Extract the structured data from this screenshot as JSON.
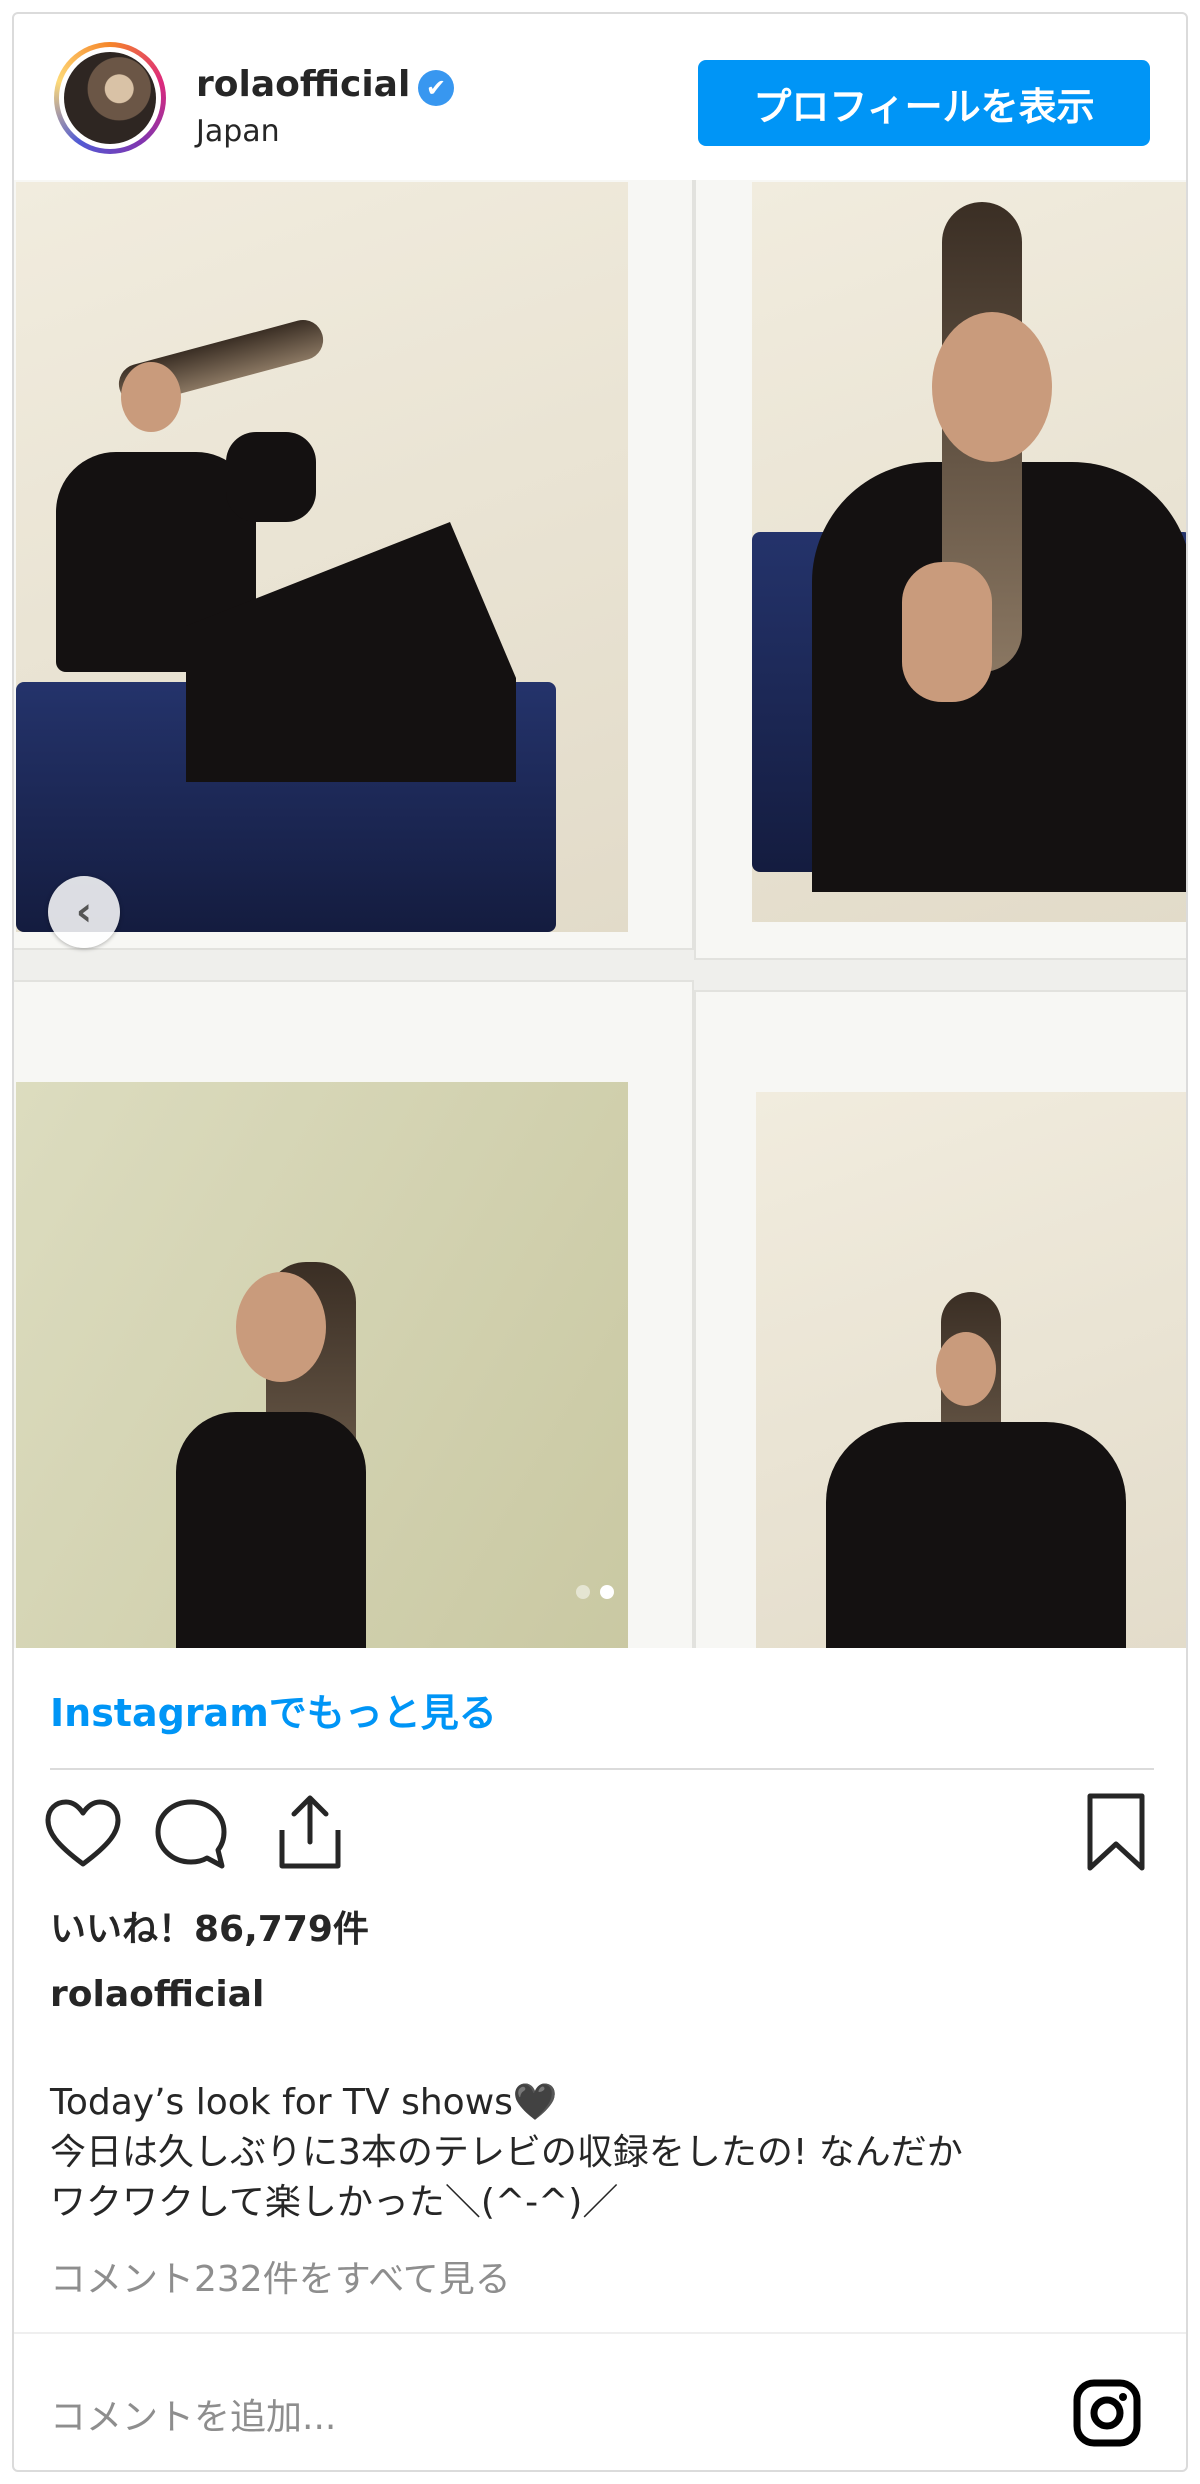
{
  "header": {
    "username": "rolaofficial",
    "verified_mark": "✔",
    "location": "Japan",
    "profile_button": "プロフィールを表示"
  },
  "carousel": {
    "prev_arrow": "‹",
    "slide_count": 2,
    "active_slide": 2
  },
  "more_link": "Instagramでもっと見る",
  "actions": {
    "like_icon": "heart-icon",
    "comment_icon": "comment-icon",
    "share_icon": "share-icon",
    "save_icon": "bookmark-icon"
  },
  "likes": "いいね！86,779件",
  "caption": {
    "username": "rolaofficial",
    "lines": [
      "Today’s look for TV shows🖤",
      "今日は久しぶりに3本のテレビの収録をしたの! なんだか",
      "ワクワクして楽しかった＼(^-^)／"
    ]
  },
  "view_comments": "コメント232件をすべて見る",
  "add_comment_placeholder": "コメントを追加...",
  "colors": {
    "accent": "#0095f6",
    "text": "#262626",
    "muted": "#8e8e8e",
    "border": "#dbdbdb"
  }
}
